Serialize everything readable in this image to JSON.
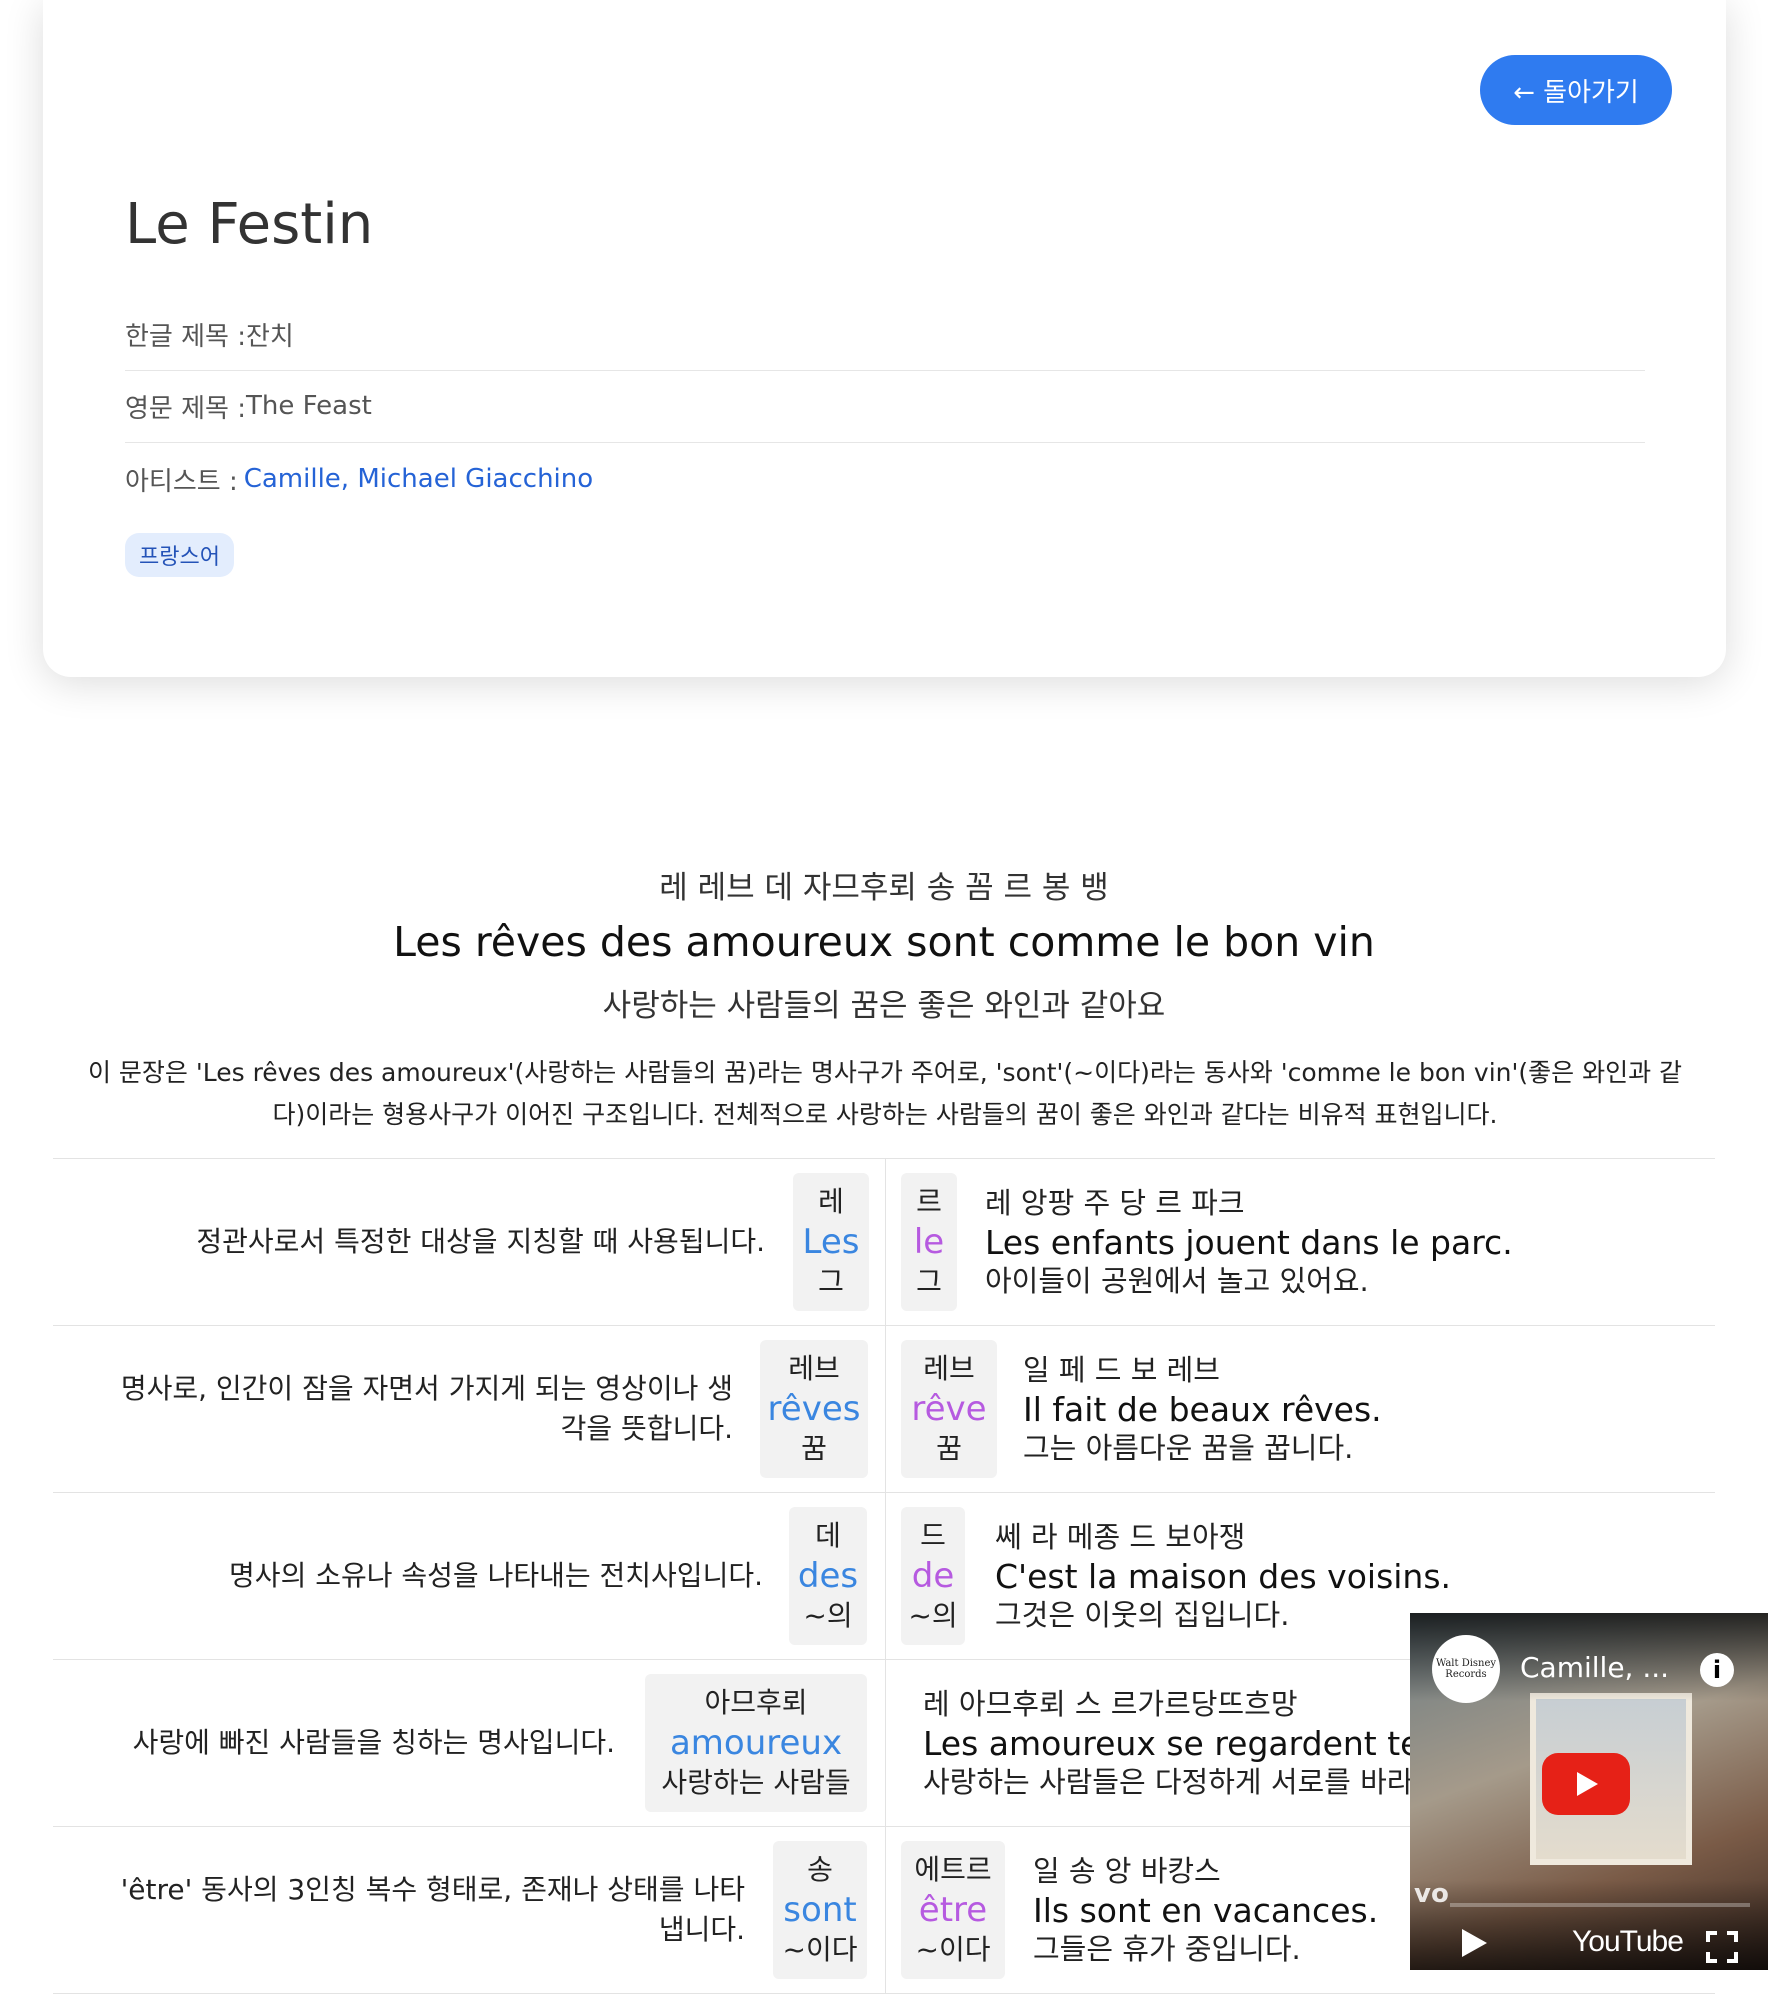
{
  "header": {
    "back_label": "← 돌아가기",
    "title": "Le Festin",
    "korean_title_label": "한글 제목 : ",
    "korean_title": "잔치",
    "english_title_label": "영문 제목 : ",
    "english_title": "The Feast",
    "artist_label": "아티스트 : ",
    "artist": "Camille, Michael Giacchino",
    "language_tag": "프랑스어"
  },
  "sentence": {
    "pronunciation": "레 레브 데 자므후뢰 송 꼼 르 봉 뱅",
    "original": "Les rêves des amoureux sont comme le bon vin",
    "translation": "사랑하는 사람들의 꿈은 좋은 와인과 같아요",
    "explanation": "이 문장은 'Les rêves des amoureux'(사랑하는 사람들의 꿈)라는 명사구가 주어로, 'sont'(~이다)라는 동사와 'comme le bon vin'(좋은 와인과 같다)이라는 형용사구가 이어진 구조입니다. 전체적으로 사랑하는 사람들의 꿈이 좋은 와인과 같다는 비유적 표현입니다."
  },
  "words": [
    {
      "description": "정관사로서 특정한 대상을 지칭할 때 사용됩니다.",
      "word_pron": "레",
      "word": "Les",
      "word_meaning": "그",
      "lemma_pron": "르",
      "lemma": "le",
      "lemma_meaning": "그",
      "example_pron": "레 앙팡 주 당 르 파크",
      "example": "Les enfants jouent dans le parc.",
      "example_trans": "아이들이 공원에서 놀고 있어요."
    },
    {
      "description": "명사로, 인간이 잠을 자면서 가지게 되는 영상이나 생각을 뜻합니다.",
      "word_pron": "레브",
      "word": "rêves",
      "word_meaning": "꿈",
      "lemma_pron": "레브",
      "lemma": "rêve",
      "lemma_meaning": "꿈",
      "example_pron": "일 페 드 보 레브",
      "example": "Il fait de beaux rêves.",
      "example_trans": "그는 아름다운 꿈을 꿉니다."
    },
    {
      "description": "명사의 소유나 속성을 나타내는 전치사입니다.",
      "word_pron": "데",
      "word": "des",
      "word_meaning": "~의",
      "lemma_pron": "드",
      "lemma": "de",
      "lemma_meaning": "~의",
      "example_pron": "쎄 라 메종 드 보아쟁",
      "example": "C'est la maison des voisins.",
      "example_trans": "그것은 이웃의 집입니다."
    },
    {
      "description": "사랑에 빠진 사람들을 칭하는 명사입니다.",
      "word_pron": "아므후뢰",
      "word": "amoureux",
      "word_meaning": "사랑하는 사람들",
      "example_pron": "레 아므후뢰 스 르가르당뜨흐망",
      "example": "Les amoureux se regardent tend",
      "example_trans": "사랑하는 사람들은 다정하게 서로를 바라"
    },
    {
      "description": "'être' 동사의 3인칭 복수 형태로, 존재나 상태를 나타냅니다.",
      "word_pron": "송",
      "word": "sont",
      "word_meaning": "~이다",
      "lemma_pron": "에트르",
      "lemma": "être",
      "lemma_meaning": "~이다",
      "example_pron": "일 송 앙 바캉스",
      "example": "Ils sont en vacances.",
      "example_trans": "그들은 휴가 중입니다."
    }
  ],
  "video": {
    "channel_logo_text": "Walt Disney Records",
    "title": "Camille, ...",
    "info_icon": "info-icon",
    "brand": "YouTube",
    "watermark": "vo"
  },
  "colors": {
    "accent": "#2f7bf0",
    "link": "#2563d6",
    "word": "#3a86e0",
    "lemma": "#b65ae0",
    "tag_bg": "#e3edfd"
  }
}
